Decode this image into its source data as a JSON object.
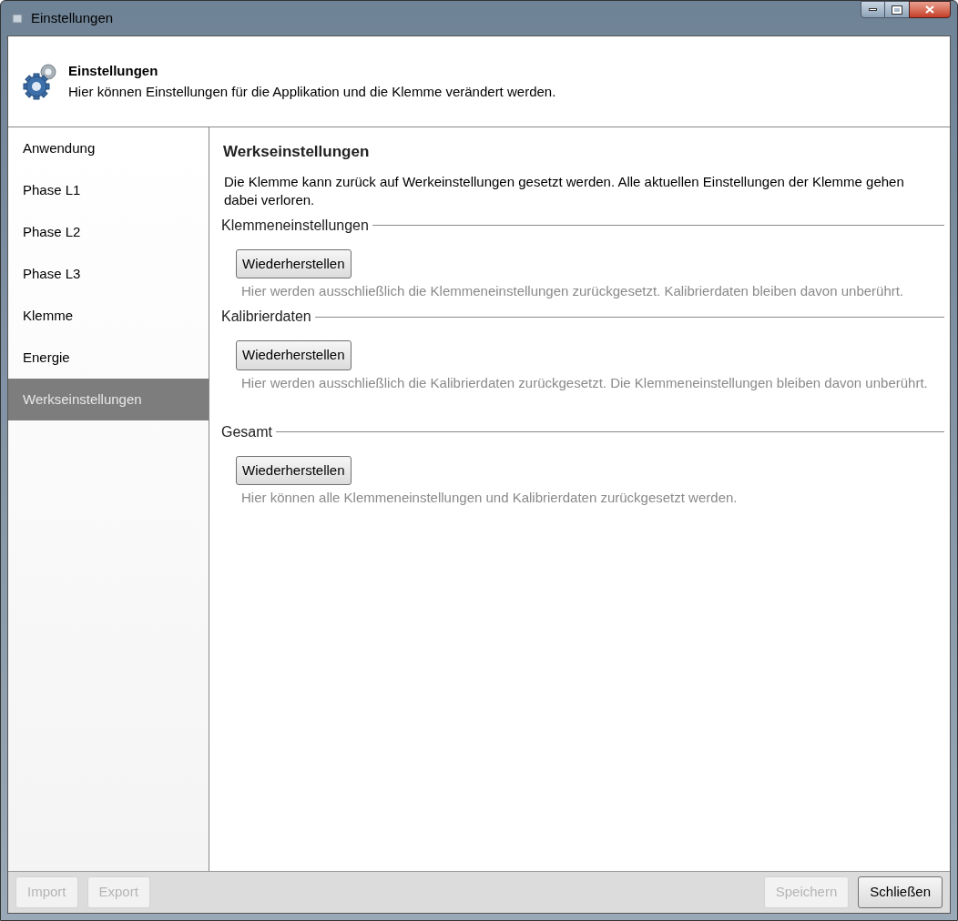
{
  "window": {
    "title": "Einstellungen"
  },
  "header": {
    "title": "Einstellungen",
    "description": "Hier können Einstellungen für die Applikation und die Klemme verändert werden."
  },
  "sidebar": {
    "items": [
      {
        "label": "Anwendung",
        "selected": false
      },
      {
        "label": "Phase L1",
        "selected": false
      },
      {
        "label": "Phase L2",
        "selected": false
      },
      {
        "label": "Phase L3",
        "selected": false
      },
      {
        "label": "Klemme",
        "selected": false
      },
      {
        "label": "Energie",
        "selected": false
      },
      {
        "label": "Werkseinstellungen",
        "selected": true
      }
    ]
  },
  "content": {
    "title": "Werkseinstellungen",
    "intro": "Die Klemme kann zurück auf Werkeinstellungen gesetzt werden. Alle aktuellen Einstellungen der Klemme gehen dabei verloren.",
    "sections": [
      {
        "heading": "Klemmeneinstellungen",
        "button": "Wiederherstellen",
        "note": "Hier werden ausschließlich die Klemmeneinstellungen zurückgesetzt. Kalibrierdaten bleiben davon unberührt."
      },
      {
        "heading": "Kalibrierdaten",
        "button": "Wiederherstellen",
        "note": "Hier werden ausschließlich die Kalibrierdaten zurückgesetzt. Die Klemmeneinstellungen bleiben davon unberührt."
      },
      {
        "heading": "Gesamt",
        "button": "Wiederherstellen",
        "note": "Hier können alle Klemmeneinstellungen und Kalibrierdaten zurückgesetzt werden."
      }
    ]
  },
  "footer": {
    "left_buttons": [
      {
        "label": "Import",
        "disabled": true
      },
      {
        "label": "Export",
        "disabled": true
      }
    ],
    "right_buttons": [
      {
        "label": "Speichern",
        "disabled": true
      },
      {
        "label": "Schließen",
        "disabled": false
      }
    ]
  }
}
